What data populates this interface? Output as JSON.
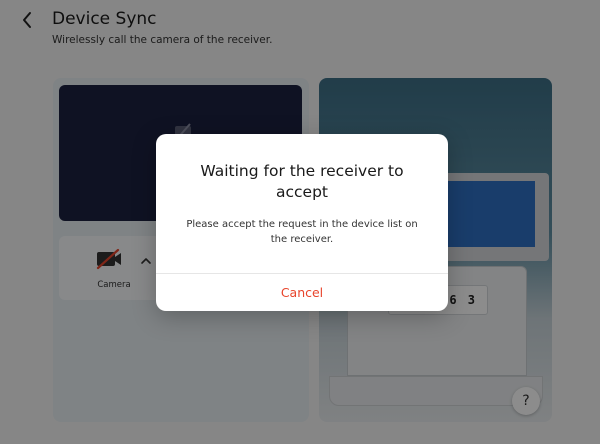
{
  "header": {
    "title": "Device Sync",
    "subtitle": "Wirelessly call the camera of the receiver."
  },
  "left_panel": {
    "camera_tile": {
      "label": "Camera",
      "icon": "camera-off-icon"
    }
  },
  "right_panel": {
    "code_digits": "5 6 3",
    "help_label": "?"
  },
  "dialog": {
    "title": "Waiting for the receiver to accept",
    "message": "Please accept the request in the device list on the receiver.",
    "cancel_label": "Cancel"
  },
  "colors": {
    "accent_red": "#e8452c",
    "preview_bg": "#1d2240",
    "overlay": "rgba(0,0,0,0.45)"
  }
}
